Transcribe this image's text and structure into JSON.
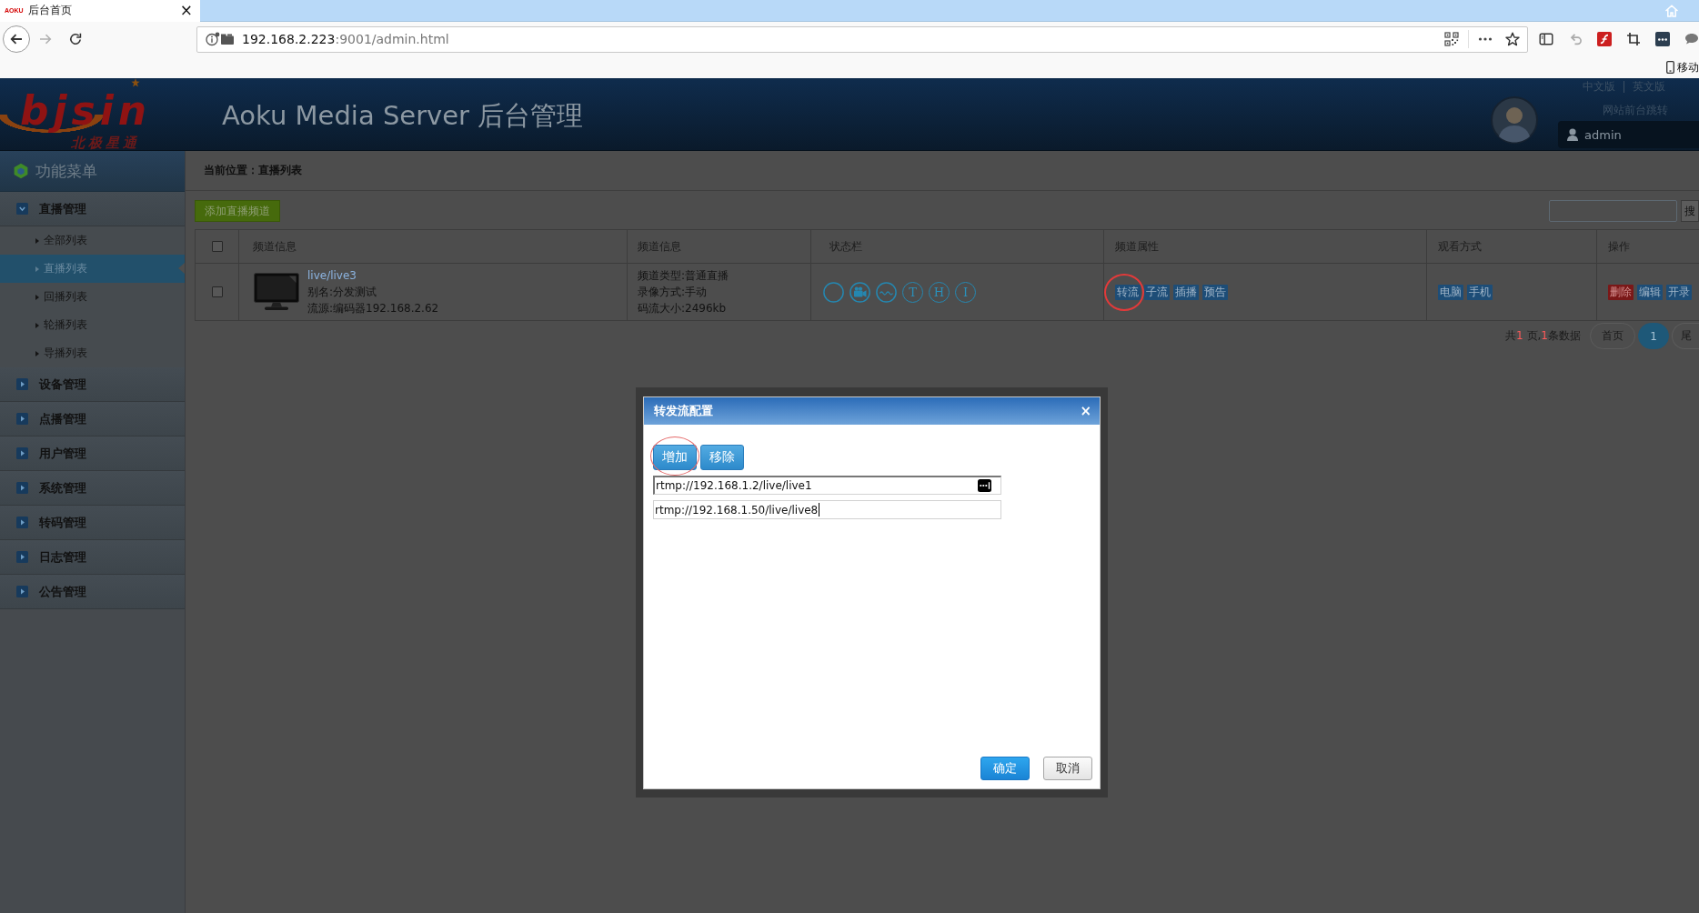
{
  "browser": {
    "tab": {
      "favicon": "AOKU",
      "title": "后台首页",
      "close": "×"
    },
    "address": {
      "host": "192.168.2.223",
      "path": ":9001/admin.html"
    },
    "bookmarks": [
      {
        "label": "移动"
      }
    ]
  },
  "header": {
    "logo": {
      "wordmark": "bjsin",
      "tagline": "北极星通"
    },
    "title": "Aoku Media Server 后台管理",
    "languages": [
      "中文版",
      "英文版"
    ],
    "frontend_link": "网站前台跳转",
    "user": "admin"
  },
  "sidebar": {
    "title": "功能菜单",
    "groups": [
      {
        "label": "直播管理",
        "expanded": true,
        "children": [
          {
            "label": "全部列表",
            "selected": false
          },
          {
            "label": "直播列表",
            "selected": true
          },
          {
            "label": "回播列表",
            "selected": false
          },
          {
            "label": "轮播列表",
            "selected": false
          },
          {
            "label": "导播列表",
            "selected": false
          }
        ]
      },
      {
        "label": "设备管理",
        "expanded": false
      },
      {
        "label": "点播管理",
        "expanded": false
      },
      {
        "label": "用户管理",
        "expanded": false
      },
      {
        "label": "系统管理",
        "expanded": false
      },
      {
        "label": "转码管理",
        "expanded": false
      },
      {
        "label": "日志管理",
        "expanded": false
      },
      {
        "label": "公告管理",
        "expanded": false
      }
    ]
  },
  "breadcrumb": "当前位置：直播列表",
  "toolbar": {
    "add_button": "添加直播频道",
    "search_button": "搜"
  },
  "table": {
    "columns": [
      {
        "kind": "checkbox",
        "checked": false
      },
      {
        "kind": "text",
        "label": "频道信息"
      },
      {
        "kind": "text",
        "label": "频道信息"
      },
      {
        "kind": "text",
        "label": "状态栏"
      },
      {
        "kind": "text",
        "label": "频道属性"
      },
      {
        "kind": "text",
        "label": "观看方式"
      },
      {
        "kind": "text",
        "label": "操作"
      }
    ],
    "rows": [
      {
        "checked": false,
        "name": "live/live3",
        "alias": "别名:分发测试",
        "source": "流源:编码器192.168.2.62",
        "details": [
          "频道类型:普通直播",
          "录像方式:手动",
          "码流大小:2496kb"
        ],
        "status": [
          {
            "kind": "blank"
          },
          {
            "kind": "camera"
          },
          {
            "kind": "wave"
          },
          {
            "kind": "letter",
            "text": "T"
          },
          {
            "kind": "letter",
            "text": "H"
          },
          {
            "kind": "letter",
            "text": "I"
          }
        ],
        "properties": [
          {
            "label": "转流",
            "annotated": true
          },
          {
            "label": "子流",
            "annotated": false
          },
          {
            "label": "插播",
            "annotated": false
          },
          {
            "label": "预告",
            "annotated": false
          }
        ],
        "viewing": [
          "电脑",
          "手机"
        ],
        "actions": [
          {
            "label": "删除",
            "kind": "danger"
          },
          {
            "label": "编辑",
            "kind": "normal"
          },
          {
            "label": "开录",
            "kind": "normal"
          }
        ]
      }
    ]
  },
  "pagination": {
    "summary": [
      {
        "kind": "plain",
        "text": "共"
      },
      {
        "kind": "count",
        "text": "1"
      },
      {
        "kind": "plain",
        "text": " 页,"
      },
      {
        "kind": "count",
        "text": "1"
      },
      {
        "kind": "plain",
        "text": "条数据"
      }
    ],
    "first": "首页",
    "pages": [
      {
        "label": "1",
        "selected": true
      }
    ],
    "last": "尾"
  },
  "dialog": {
    "title": "转发流配置",
    "close": "×",
    "buttons": [
      {
        "label": "增加",
        "annotated": true
      },
      {
        "label": "移除",
        "annotated": false
      }
    ],
    "urls": [
      {
        "value": "rtmp://192.168.1.2/live/live1",
        "autofill_icon": true,
        "focused": false
      },
      {
        "value": "rtmp://192.168.1.50/live/live8",
        "autofill_icon": false,
        "focused": true
      }
    ],
    "footer": [
      {
        "label": "确定",
        "kind": "primary"
      },
      {
        "label": "取消",
        "kind": "secondary"
      }
    ]
  }
}
